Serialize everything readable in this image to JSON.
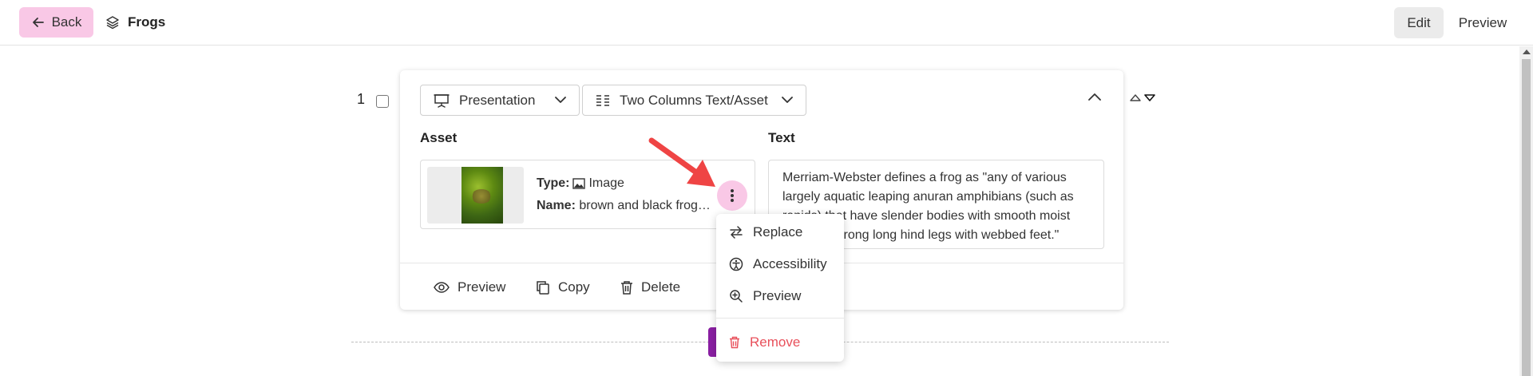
{
  "header": {
    "back_label": "Back",
    "title": "Frogs",
    "mode_edit": "Edit",
    "mode_preview": "Preview"
  },
  "slide": {
    "number": "1",
    "type_select": "Presentation",
    "layout_select": "Two Columns Text/Asset",
    "asset_label": "Asset",
    "text_label": "Text",
    "asset": {
      "type_key": "Type:",
      "type_value": "Image",
      "name_key": "Name:",
      "name_value": "brown and black frog on green grass"
    },
    "text_content": "Merriam-Webster defines a frog as \"any of various largely aquatic leaping anuran amphibians (such as ranids) that have slender bodies with smooth moist skin and strong long hind legs with webbed feet.\"",
    "footer": {
      "preview": "Preview",
      "copy": "Copy",
      "delete": "Delete"
    }
  },
  "asset_menu": {
    "replace": "Replace",
    "accessibility": "Accessibility",
    "preview": "Preview",
    "remove": "Remove"
  },
  "colors": {
    "accent_pink": "#f9c8e6",
    "danger": "#e8505b",
    "annotation": "#ef4444",
    "add_button": "#8a1fa3"
  }
}
